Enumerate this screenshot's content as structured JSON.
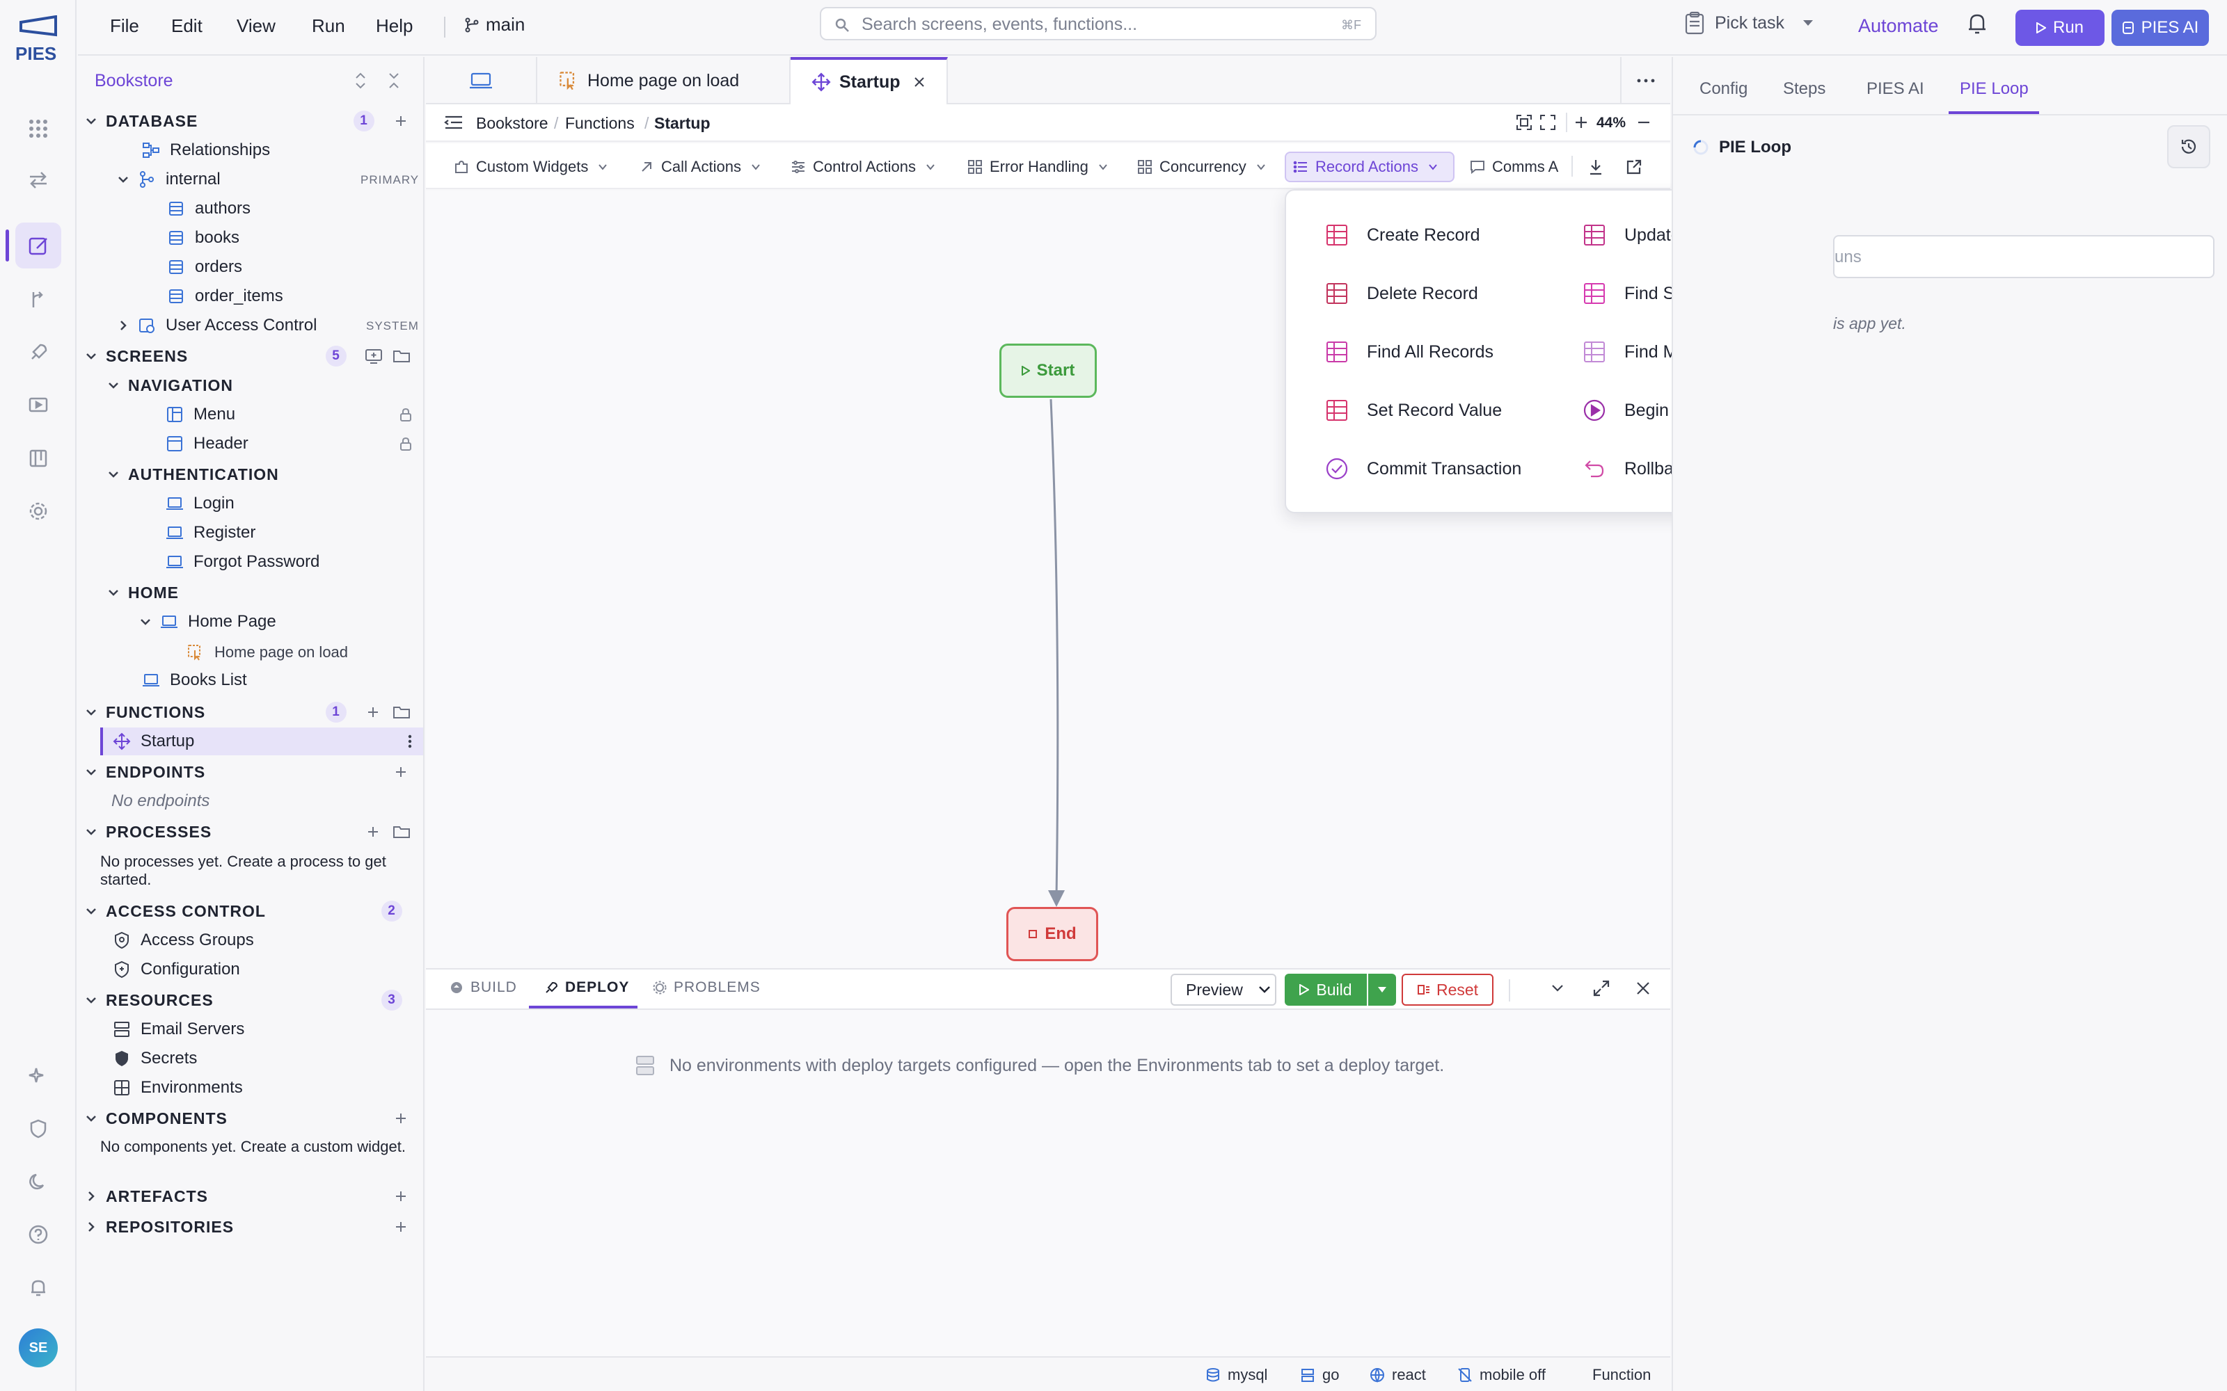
{
  "app": {
    "logo_text": "PIES",
    "avatar_initials": "SE"
  },
  "menu": {
    "file": "File",
    "edit": "Edit",
    "view": "View",
    "run": "Run",
    "help": "Help",
    "branch": "main"
  },
  "search": {
    "placeholder": "Search screens, events, functions...",
    "shortcut": "⌘F"
  },
  "topright": {
    "pick_task": "Pick task",
    "automate": "Automate",
    "run": "Run",
    "pies_ai": "PIES AI"
  },
  "sidebar": {
    "project": "Bookstore",
    "database": {
      "label": "DATABASE",
      "count": "1",
      "relationships": "Relationships",
      "internal": "internal",
      "internal_tag": "PRIMARY",
      "tables": [
        "authors",
        "books",
        "orders",
        "order_items"
      ],
      "uac": "User Access Control",
      "uac_tag": "SYSTEM"
    },
    "screens": {
      "label": "SCREENS",
      "count": "5",
      "navigation": "NAVIGATION",
      "menu": "Menu",
      "header": "Header",
      "authentication": "AUTHENTICATION",
      "login": "Login",
      "register": "Register",
      "forgot": "Forgot Password",
      "home": "HOME",
      "home_page": "Home Page",
      "home_page_on_load": "Home page on load",
      "books_list": "Books List"
    },
    "functions": {
      "label": "FUNCTIONS",
      "count": "1",
      "startup": "Startup"
    },
    "endpoints": {
      "label": "ENDPOINTS",
      "empty": "No endpoints"
    },
    "processes": {
      "label": "PROCESSES",
      "empty": "No processes yet. Create a process to get started."
    },
    "access_control": {
      "label": "ACCESS CONTROL",
      "count": "2",
      "groups": "Access Groups",
      "config": "Configuration"
    },
    "resources": {
      "label": "RESOURCES",
      "count": "3",
      "email": "Email Servers",
      "secrets": "Secrets",
      "envs": "Environments"
    },
    "components": {
      "label": "COMPONENTS",
      "empty": "No components yet. Create a custom widget."
    },
    "artefacts": {
      "label": "ARTEFACTS"
    },
    "repositories": {
      "label": "REPOSITORIES"
    }
  },
  "tabs": {
    "home_page_on_load": "Home page on load",
    "startup": "Startup"
  },
  "breadcrumb": {
    "a": "Bookstore",
    "b": "Functions",
    "c": "Startup",
    "zoom": "44%"
  },
  "toolbar": {
    "custom_widgets": "Custom Widgets",
    "call_actions": "Call Actions",
    "control_actions": "Control Actions",
    "error_handling": "Error Handling",
    "concurrency": "Concurrency",
    "record_actions": "Record Actions",
    "comms": "Comms A"
  },
  "canvas": {
    "start": "Start",
    "end": "End"
  },
  "record_menu": {
    "create": "Create Record",
    "update": "Update Record",
    "delete": "Delete Record",
    "find_single": "Find Single Record",
    "find_all": "Find All Records",
    "find_multiple": "Find Multiple Records",
    "set_value": "Set Record Value",
    "begin": "Begin Transaction",
    "commit": "Commit Transaction",
    "rollback": "Rollback Transaction"
  },
  "bottom": {
    "build_tab": "BUILD",
    "deploy_tab": "DEPLOY",
    "problems_tab": "PROBLEMS",
    "env_select": "Preview",
    "build_btn": "Build",
    "reset_btn": "Reset",
    "message": "No environments with deploy targets configured — open the Environments tab to set a deploy target."
  },
  "status": {
    "db": "mysql",
    "lang": "go",
    "ui": "react",
    "mobile": "mobile off",
    "kind": "Function"
  },
  "right": {
    "config": "Config",
    "steps": "Steps",
    "pies_ai": "PIES AI",
    "pie_loop": "PIE Loop",
    "title": "PIE Loop",
    "input_partial": "uns",
    "empty_partial": "is app yet."
  },
  "colors": {
    "accent": "#6d45d6",
    "run": "#6d58e6",
    "start": "#5cb85c",
    "end": "#e05555",
    "record_icon": "#d6336c"
  }
}
